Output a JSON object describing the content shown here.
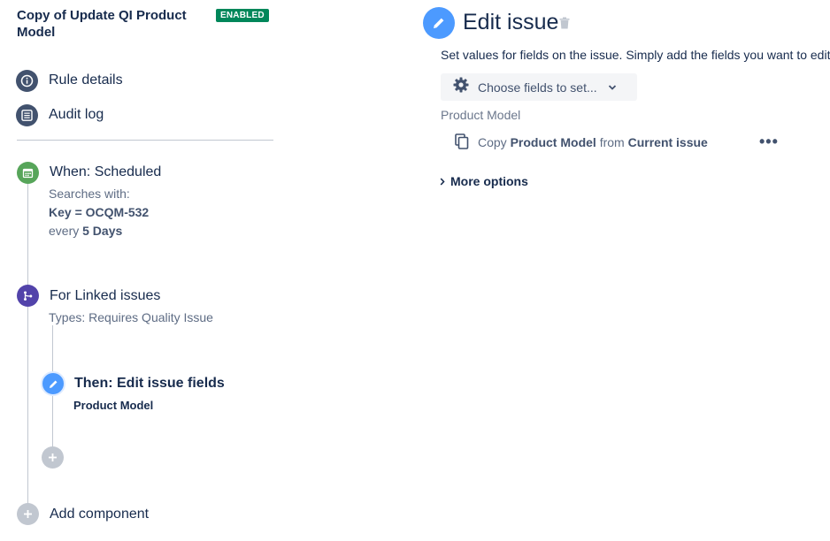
{
  "rule": {
    "title": "Copy of Update QI Product Model",
    "status_badge": "ENABLED"
  },
  "nav": {
    "rule_details": "Rule details",
    "audit_log": "Audit log"
  },
  "trigger": {
    "title": "When: Scheduled",
    "line1": "Searches with:",
    "jql_prefix": "Key = OCQM-532",
    "every_prefix": "every",
    "every_value": "5 Days"
  },
  "branch": {
    "title": "For Linked issues",
    "types": "Types: Requires Quality Issue"
  },
  "action": {
    "title": "Then: Edit issue fields",
    "subtitle": "Product Model"
  },
  "add_component": "Add component",
  "editor": {
    "title": "Edit issue",
    "description": "Set values for fields on the issue. Simply add the fields you want to edit",
    "choose_button": "Choose fields to set...",
    "field_label": "Product Model",
    "copy_word": "Copy",
    "copy_field": "Product Model",
    "from_word": "from",
    "copy_source": "Current issue",
    "more_options": "More options"
  },
  "colors": {
    "enabled_badge": "#00875a",
    "trigger_icon": "#57a55a",
    "branch_icon": "#5243aa",
    "action_icon": "#4c9aff",
    "nav_icon": "#42526e"
  },
  "icons": {
    "rule_details": "info-icon",
    "audit_log": "list-icon",
    "trigger": "calendar-icon",
    "branch": "branch-icon",
    "action": "pencil-icon",
    "choose": "gear-icon",
    "copy": "copy-icon",
    "trash": "trash-icon"
  }
}
